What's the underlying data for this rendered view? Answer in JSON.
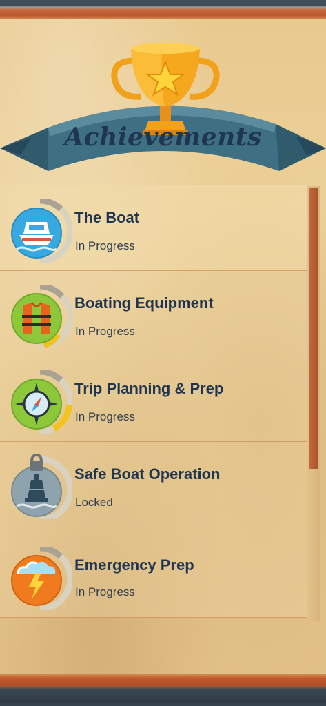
{
  "header": {
    "title": "Achievements"
  },
  "colors": {
    "title": "#1f3550",
    "ribbon": "#3e6f82",
    "trophy": "#f2a11b",
    "scroll_thumb": "#b25a2f"
  },
  "achievements": [
    {
      "title": "The Boat",
      "status": "In Progress",
      "icon": "boat-icon",
      "badge_color": "#38a8e0"
    },
    {
      "title": "Boating Equipment",
      "status": "In Progress",
      "icon": "life-jacket-icon",
      "badge_color": "#8cc83a"
    },
    {
      "title": "Trip Planning & Prep",
      "status": "In Progress",
      "icon": "compass-icon",
      "badge_color": "#8cc83a"
    },
    {
      "title": "Safe Boat Operation",
      "status": "Locked",
      "icon": "buoy-icon",
      "badge_color": "#8ea3ad"
    },
    {
      "title": "Emergency Prep",
      "status": "In Progress",
      "icon": "storm-icon",
      "badge_color": "#f07a1e"
    }
  ]
}
